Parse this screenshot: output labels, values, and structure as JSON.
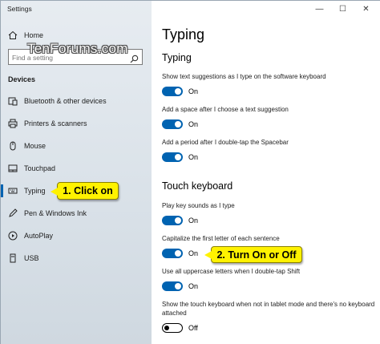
{
  "app": {
    "title": "Settings"
  },
  "window_controls": {
    "minimize": "—",
    "maximize": "☐",
    "close": "✕"
  },
  "watermark": "TenForums.com",
  "sidebar": {
    "home": {
      "label": "Home",
      "icon": "home-icon"
    },
    "search": {
      "placeholder": "Find a setting",
      "icon": "search-icon"
    },
    "section_label": "Devices",
    "items": [
      {
        "label": "Bluetooth & other devices",
        "icon": "bluetooth-icon"
      },
      {
        "label": "Printers & scanners",
        "icon": "printer-icon"
      },
      {
        "label": "Mouse",
        "icon": "mouse-icon"
      },
      {
        "label": "Touchpad",
        "icon": "touchpad-icon"
      },
      {
        "label": "Typing",
        "icon": "keyboard-icon",
        "selected": true
      },
      {
        "label": "Pen & Windows Ink",
        "icon": "pen-icon"
      },
      {
        "label": "AutoPlay",
        "icon": "autoplay-icon"
      },
      {
        "label": "USB",
        "icon": "usb-icon"
      }
    ]
  },
  "callouts": {
    "click_on": "1. Click on",
    "turn_on_off": "2. Turn On or Off"
  },
  "main": {
    "page_title": "Typing",
    "typing_heading": "Typing",
    "touch_heading": "Touch keyboard",
    "options": [
      {
        "desc": "Show text suggestions as I type on the software keyboard",
        "state": "On"
      },
      {
        "desc": "Add a space after I choose a text suggestion",
        "state": "On"
      },
      {
        "desc": "Add a period after I double-tap the Spacebar",
        "state": "On"
      },
      {
        "desc": "Play key sounds as I type",
        "state": "On"
      },
      {
        "desc": "Capitalize the first letter of each sentence",
        "state": "On"
      },
      {
        "desc": "Use all uppercase letters when I double-tap Shift",
        "state": "On"
      },
      {
        "desc": "Show the touch keyboard when not in tablet mode and there's no keyboard attached",
        "state": "Off"
      }
    ]
  },
  "colors": {
    "accent": "#0063b1",
    "callout": "#fff200",
    "sidebar_bg": "#dde4ea"
  }
}
